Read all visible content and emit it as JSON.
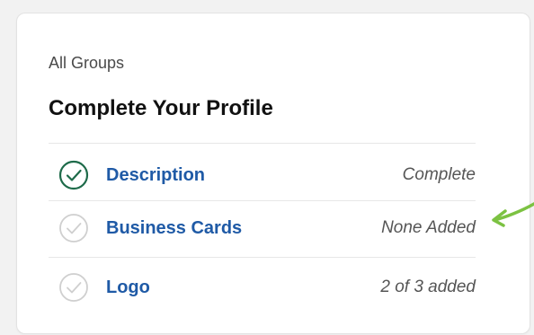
{
  "breadcrumb": "All Groups",
  "title": "Complete Your Profile",
  "items": [
    {
      "label": "Description",
      "status": "Complete",
      "done": true,
      "icon": "check-circle-icon"
    },
    {
      "label": "Business Cards",
      "status": "None Added",
      "done": false,
      "icon": "check-circle-icon"
    },
    {
      "label": "Logo",
      "status": "2 of 3 added",
      "done": false,
      "icon": "check-circle-icon"
    }
  ],
  "colors": {
    "complete": "#1e6b4a",
    "incomplete": "#cfcfcf",
    "link": "#1f5aa6",
    "arrow": "#7cc242"
  }
}
